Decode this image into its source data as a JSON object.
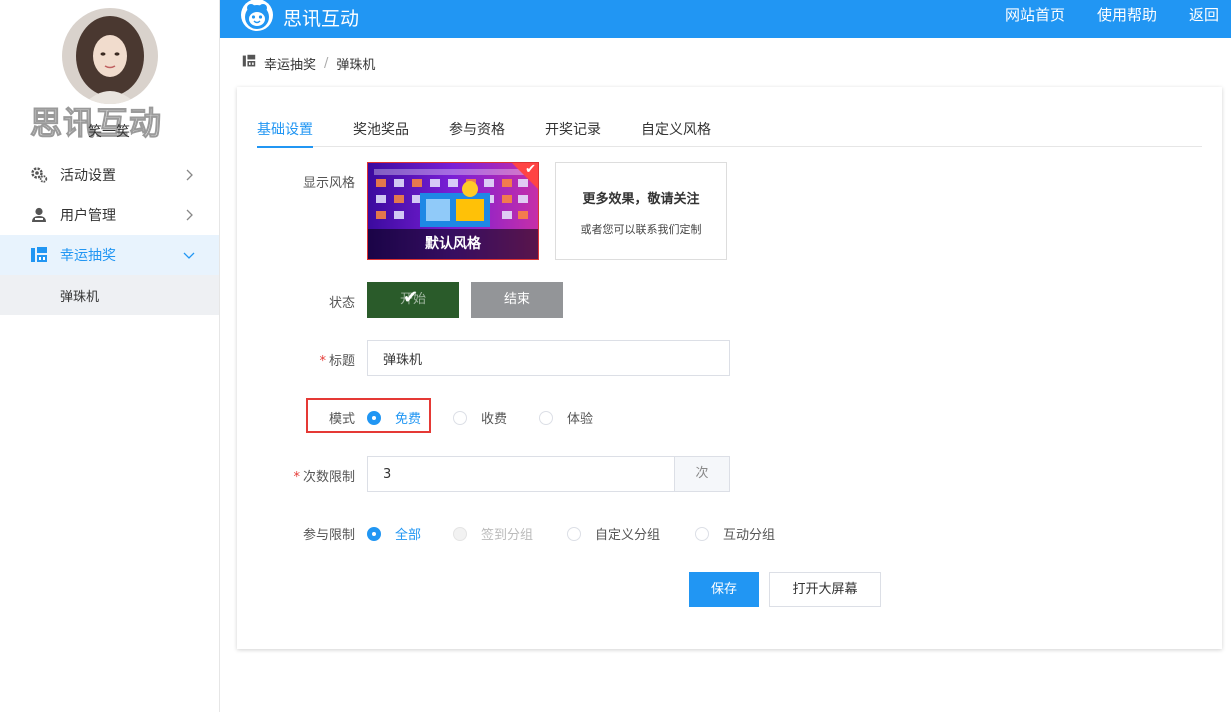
{
  "sidebar": {
    "watermark": "思讯互动",
    "username": "笑一笑",
    "menu": [
      {
        "label": "活动设置",
        "icon": "gear-icon"
      },
      {
        "label": "用户管理",
        "icon": "user-icon"
      },
      {
        "label": "幸运抽奖",
        "icon": "lottery-icon"
      }
    ],
    "submenu": [
      {
        "label": "弹珠机"
      }
    ]
  },
  "header": {
    "brand": "思讯互动",
    "nav": [
      "网站首页",
      "使用帮助",
      "返回"
    ]
  },
  "breadcrumb": {
    "items": [
      "幸运抽奖",
      "弹珠机"
    ],
    "separator": "/"
  },
  "tabs": [
    {
      "label": "基础设置",
      "active": true
    },
    {
      "label": "奖池奖品",
      "active": false
    },
    {
      "label": "参与资格",
      "active": false
    },
    {
      "label": "开奖记录",
      "active": false
    },
    {
      "label": "自定义风格",
      "active": false
    }
  ],
  "form": {
    "style": {
      "label": "显示风格",
      "default_caption": "默认风格",
      "more_title": "更多效果，敬请关注",
      "more_sub": "或者您可以联系我们定制"
    },
    "status": {
      "label": "状态",
      "start": "开始",
      "end": "结束"
    },
    "title": {
      "label": "标题",
      "required_mark": "*",
      "value": "弹珠机"
    },
    "mode": {
      "label": "模式",
      "options": [
        "免费",
        "收费",
        "体验"
      ],
      "selected": "免费"
    },
    "count": {
      "label": "次数限制",
      "required_mark": "*",
      "value": "3",
      "unit": "次"
    },
    "participation": {
      "label": "参与限制",
      "options": [
        "全部",
        "签到分组",
        "自定义分组",
        "互动分组"
      ],
      "selected": "全部"
    },
    "buttons": {
      "save": "保存",
      "big_screen": "打开大屏幕"
    }
  },
  "colors": {
    "primary": "#2196f3",
    "start_button": "#2a5b2a",
    "end_button": "#939598",
    "highlight": "#e53935"
  }
}
